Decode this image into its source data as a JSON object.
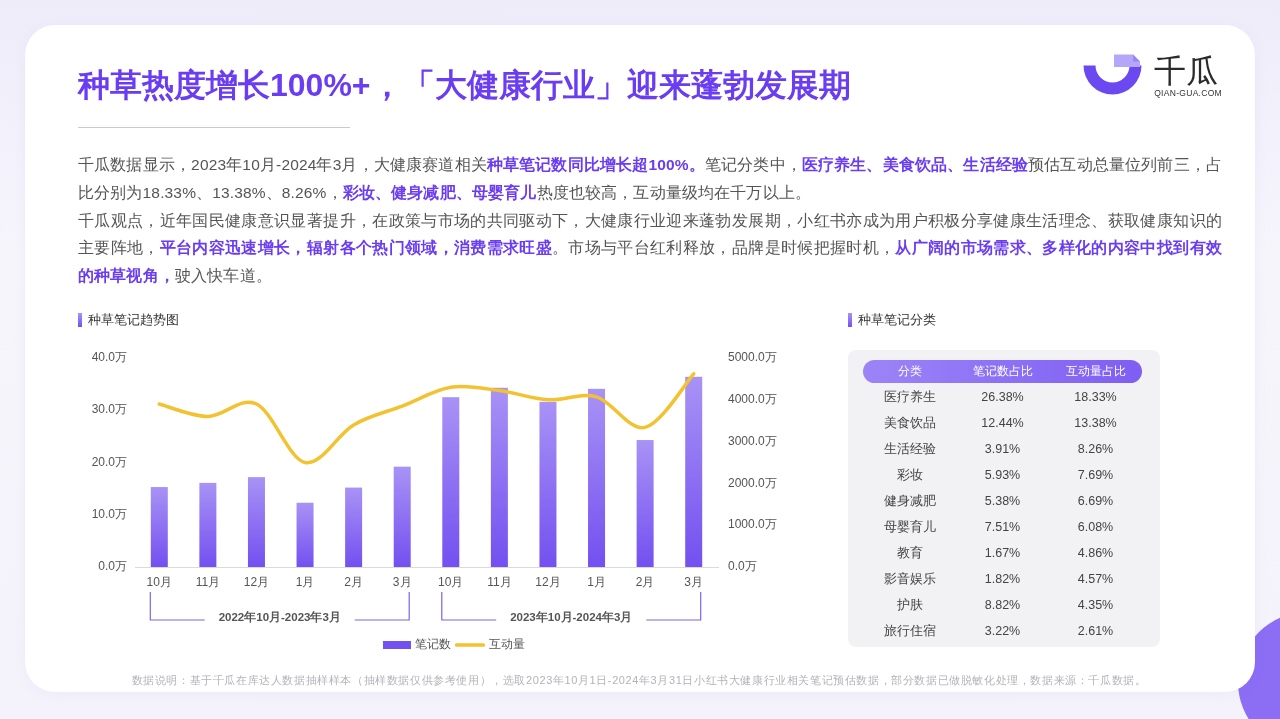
{
  "header": {
    "title": "种草热度增长100%+，「大健康行业」迎来蓬勃发展期",
    "logo": {
      "name": "千瓜",
      "domain": "QIAN-GUA.COM"
    }
  },
  "summary": [
    "千瓜数据显示，2023年10月-2024年3月，大健康赛道相关**种草笔记数同比增长超100%。**笔记分类中，**医疗养生、美食饮品、生活经验**预估互动总量位列前三，占比分别为18.33%、13.38%、8.26%，**彩妆、健身减肥、母婴育儿**热度也较高，互动量级均在千万以上。",
    "千瓜观点，近年国民健康意识显著提升，在政策与市场的共同驱动下，大健康行业迎来蓬勃发展期，小红书亦成为用户积极分享健康生活理念、获取健康知识的主要阵地，**平台内容迅速增长，辐射各个热门领域，消费需求旺盛**。市场与平台红利释放，品牌是时候把握时机，**从广阔的市场需求、多样化的内容中找到有效的种草视角，**驶入快车道。"
  ],
  "trend_panel": {
    "title": "种草笔记趋势图",
    "chart_data": {
      "type": "bar",
      "categories": [
        "10月",
        "11月",
        "12月",
        "1月",
        "2月",
        "3月",
        "10月",
        "11月",
        "12月",
        "1月",
        "2月",
        "3月"
      ],
      "series": [
        {
          "name": "笔记数",
          "type": "bar",
          "color": "#7350f0",
          "values": [
            15.3,
            16.1,
            17.2,
            12.3,
            15.2,
            19.2,
            32.5,
            34.3,
            31.6,
            34.1,
            24.3,
            36.4
          ]
        },
        {
          "name": "互动量",
          "type": "line",
          "axis": "y2",
          "color": "#f2c230",
          "values": [
            3900,
            3600,
            3900,
            2500,
            3400,
            3850,
            4300,
            4220,
            4000,
            4070,
            3340,
            4620
          ]
        }
      ],
      "ylim": [
        0,
        40
      ],
      "yticks": [
        {
          "value": 0,
          "label": "0.0万"
        },
        {
          "value": 10,
          "label": "10.0万"
        },
        {
          "value": 20,
          "label": "20.0万"
        },
        {
          "value": 30,
          "label": "30.0万"
        },
        {
          "value": 40,
          "label": "40.0万"
        }
      ],
      "y2lim": [
        0,
        5000
      ],
      "y2ticks": [
        {
          "value": 0,
          "label": "0.0万"
        },
        {
          "value": 1000,
          "label": "1000.0万"
        },
        {
          "value": 2000,
          "label": "2000.0万"
        },
        {
          "value": 3000,
          "label": "3000.0万"
        },
        {
          "value": 4000,
          "label": "4000.0万"
        },
        {
          "value": 5000,
          "label": "5000.0万"
        }
      ],
      "legend": "bottom"
    },
    "period_labels": [
      "2022年10月-2023年3月",
      "2023年10月-2024年3月"
    ]
  },
  "category_panel": {
    "title": "种草笔记分类",
    "table": {
      "columns": [
        "分类",
        "笔记数占比",
        "互动量占比"
      ],
      "rows": [
        [
          "医疗养生",
          "26.38%",
          "18.33%"
        ],
        [
          "美食饮品",
          "12.44%",
          "13.38%"
        ],
        [
          "生活经验",
          "3.91%",
          "8.26%"
        ],
        [
          "彩妆",
          "5.93%",
          "7.69%"
        ],
        [
          "健身减肥",
          "5.38%",
          "6.69%"
        ],
        [
          "母婴育儿",
          "7.51%",
          "6.08%"
        ],
        [
          "教育",
          "1.67%",
          "4.86%"
        ],
        [
          "影音娱乐",
          "1.82%",
          "4.57%"
        ],
        [
          "护肤",
          "8.82%",
          "4.35%"
        ],
        [
          "旅行住宿",
          "3.22%",
          "2.61%"
        ]
      ]
    }
  },
  "footnote": "数据说明：基于千瓜在库达人数据抽样样本（抽样数据仅供参考使用），选取2023年10月1日-2024年3月31日小红书大健康行业相关笔记预估数据，部分数据已做脱敏化处理，数据来源：千瓜数据。"
}
